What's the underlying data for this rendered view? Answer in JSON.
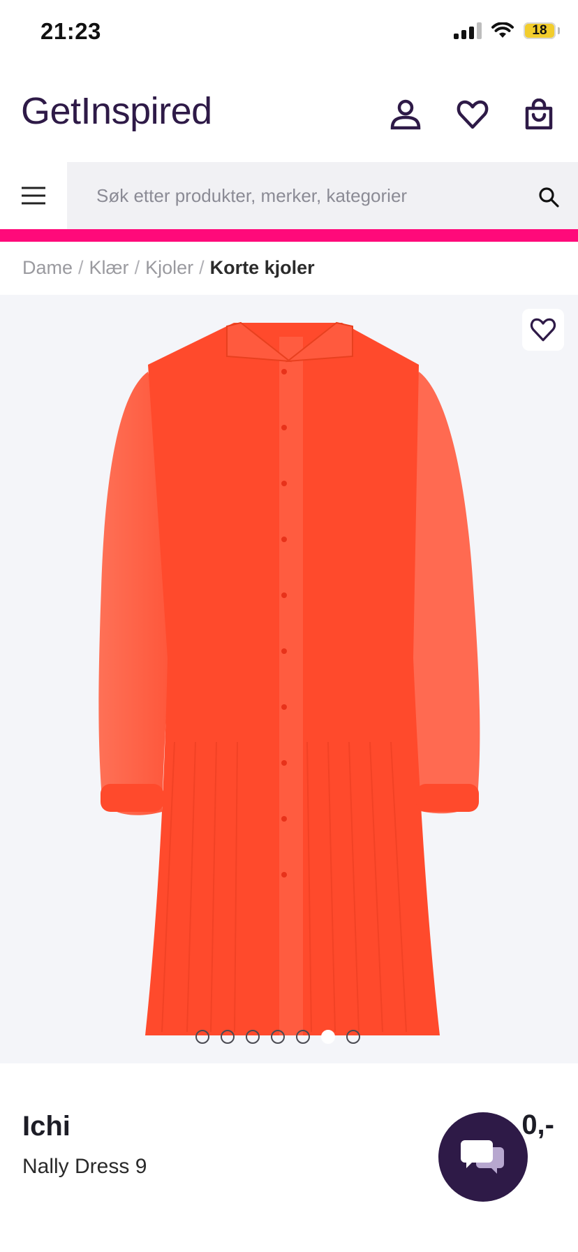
{
  "status_bar": {
    "time": "21:23",
    "battery_level": "18",
    "battery_color": "#f2cd2c",
    "icons": [
      "signal-icon",
      "wifi-icon",
      "battery-icon"
    ]
  },
  "header": {
    "logo": "GetInspired",
    "brand_color": "#2e1a47",
    "icons": [
      "account-icon",
      "heart-icon",
      "shopping-bag-icon"
    ]
  },
  "search": {
    "placeholder": "Søk etter produkter, merker, kategorier",
    "value": "",
    "menu_icon": "hamburger-menu-icon",
    "search_icon": "search-icon"
  },
  "accent_color": "#ff0a7a",
  "breadcrumb": {
    "items": [
      "Dame",
      "Klær",
      "Kjoler"
    ],
    "separator": "/",
    "current": "Korte kjoler"
  },
  "gallery": {
    "image_subject": "orange-red pleated shirt dress with long sheer sleeves",
    "dress_color": "#ff4a2c",
    "favorite_icon": "heart-outline-icon",
    "dot_count": 7,
    "active_dot_index": 5
  },
  "product": {
    "brand": "Ichi",
    "name": "Nally Dress 9",
    "price_visible": "0,-"
  },
  "chat": {
    "icon": "chat-bubbles-icon"
  }
}
